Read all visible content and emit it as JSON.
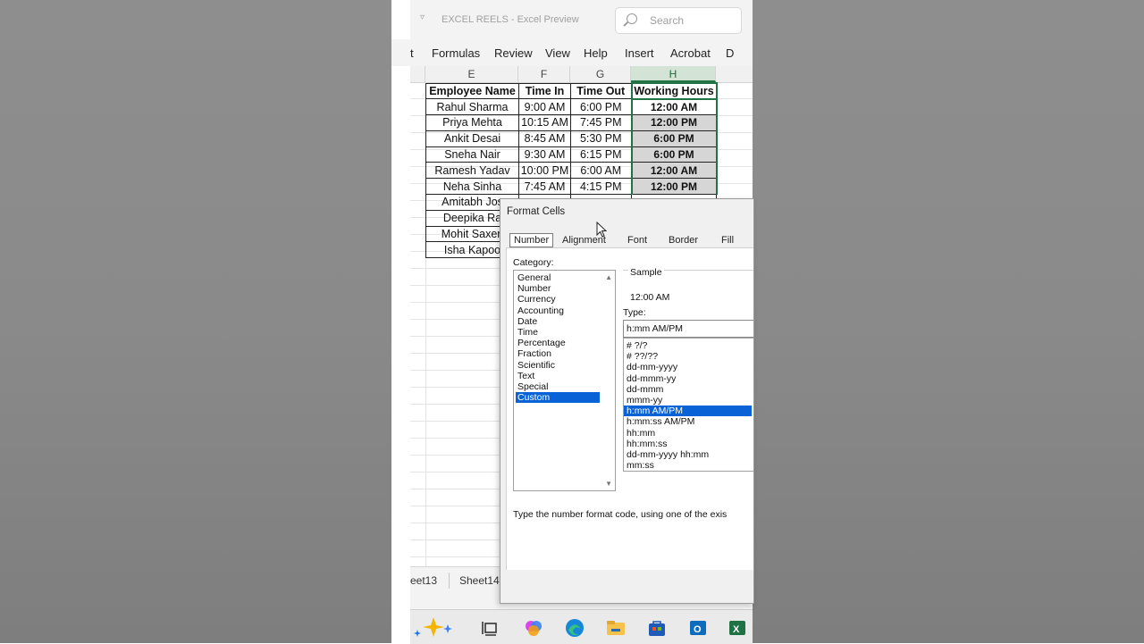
{
  "app": {
    "doc_title": "EXCEL REELS  -  Excel Preview",
    "search_placeholder": "Search"
  },
  "ribbon": {
    "tabs": [
      "t",
      "Formulas",
      "Review",
      "View",
      "Help",
      "Insert",
      "Acrobat",
      "D"
    ]
  },
  "sheet": {
    "columns": [
      "E",
      "F",
      "G",
      "H"
    ],
    "selected_column": "H",
    "headers": [
      "Employee Name",
      "Time In",
      "Time Out",
      "Working Hours"
    ],
    "rows": [
      [
        "Rahul Sharma",
        "9:00 AM",
        "6:00 PM",
        "12:00 AM"
      ],
      [
        "Priya Mehta",
        "10:15 AM",
        "7:45 PM",
        "12:00 PM"
      ],
      [
        "Ankit Desai",
        "8:45 AM",
        "5:30 PM",
        "6:00 PM"
      ],
      [
        "Sneha Nair",
        "9:30 AM",
        "6:15 PM",
        "6:00 PM"
      ],
      [
        "Ramesh Yadav",
        "10:00 PM",
        "6:00 AM",
        "12:00 AM"
      ],
      [
        "Neha Sinha",
        "7:45 AM",
        "4:15 PM",
        "12:00 PM"
      ],
      [
        "Amitabh Jos",
        "",
        "",
        ""
      ],
      [
        "Deepika Ra",
        "",
        "",
        ""
      ],
      [
        "Mohit Saxen",
        "",
        "",
        ""
      ],
      [
        "Isha Kapoo",
        "",
        "",
        ""
      ]
    ],
    "sheet_tabs": [
      "eet13",
      "Sheet14"
    ]
  },
  "dialog": {
    "title": "Format Cells",
    "tabs": [
      "Number",
      "Alignment",
      "Font",
      "Border",
      "Fill"
    ],
    "active_tab": "Number",
    "category_label": "Category:",
    "categories": [
      "General",
      "Number",
      "Currency",
      "Accounting",
      "Date",
      "Time",
      "Percentage",
      "Fraction",
      "Scientific",
      "Text",
      "Special",
      "Custom"
    ],
    "selected_category": "Custom",
    "sample_label": "Sample",
    "sample_value": "12:00 AM",
    "type_label": "Type:",
    "type_value": "h:mm AM/PM",
    "types": [
      "# ?/?",
      "# ??/??",
      "dd-mm-yyyy",
      "dd-mmm-yy",
      "dd-mmm",
      "mmm-yy",
      "h:mm AM/PM",
      "h:mm:ss AM/PM",
      "hh:mm",
      "hh:mm:ss",
      "dd-mm-yyyy hh:mm",
      "mm:ss"
    ],
    "selected_type": "h:mm AM/PM",
    "help_text": "Type the number format code, using one of the exis"
  },
  "taskbar": {
    "icons": [
      "copilot-icon",
      "task-view-icon",
      "copilot-app-icon",
      "edge-icon",
      "file-explorer-icon",
      "store-icon",
      "outlook-icon",
      "excel-icon"
    ]
  },
  "colors": {
    "excel_green": "#217346",
    "selection_blue": "#0a63d6",
    "working_hours_fill": "#d6d6d6"
  }
}
